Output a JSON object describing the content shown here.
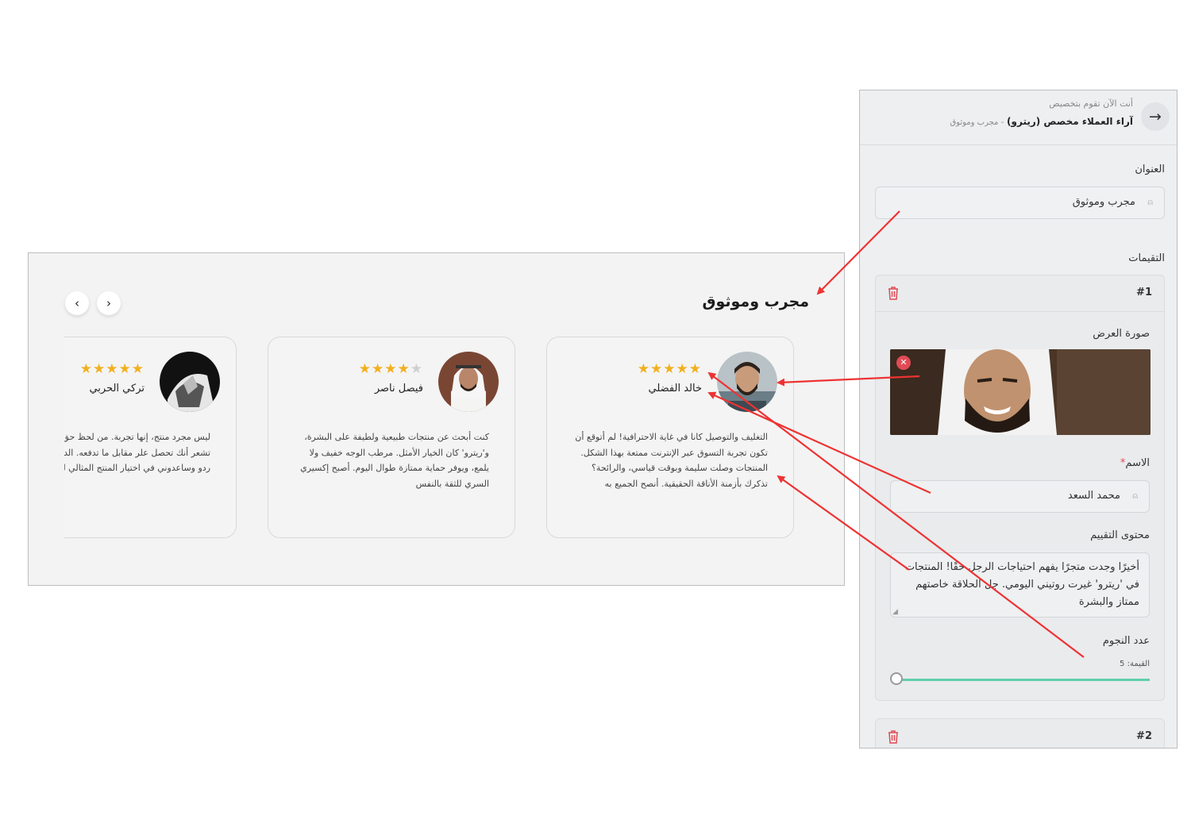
{
  "preview": {
    "section_title": "مجرب وموثوق",
    "prev_label": "‹",
    "next_label": "›",
    "cards": [
      {
        "name": "خالد الفضلي",
        "rating": 5,
        "stars": "★★★★★",
        "text": "التغليف والتوصيل كانا في غاية الاحترافية! لم أتوقع أن تكون تجربة التسوق عبر الإنترنت ممتعة بهذا الشكل. المنتجات وصلت سليمة وبوقت قياسي، والرائحة؟ تذكرك بأزمنة الأناقة الحقيقية. أنصح الجميع به"
      },
      {
        "name": "فيصل ناصر",
        "rating": 4,
        "stars_on": "★★★★",
        "stars_off": "★",
        "text": "كنت أبحث عن منتجات طبيعية ولطيفة على البشرة، و'ريترو' كان الخيار الأمثل. مرطب الوجه خفيف ولا يلمع، ويوفر حماية ممتازة طوال اليوم. أصبح إكسيري السري للثقة بالنفس"
      },
      {
        "name": "تركي الحربي",
        "rating": 5,
        "stars": "★★★★★",
        "text": "ليس مجرد منتج، إنها تجربة. من لحظ حق الاستخدام، تشعر أنك تحصل علر مقابل ما تدفعه. الدعم الفني كان ردو وساعدوني في اختيار المنتج المثالي لشد"
      }
    ]
  },
  "panel": {
    "subtitle": "أنت الآن تقوم بتخصيص",
    "title": "آراء العملاء مخصص (ريترو)",
    "crumb": "- مجرب وموثوق",
    "back_icon": "arrow-right-icon",
    "title_label": "العنوان",
    "title_value": "مجرب وموثوق",
    "ratings_label": "التقيمات",
    "items": [
      {
        "number": "#1",
        "image_label": "صورة العرض",
        "name_label": "الاسم",
        "required_mark": "*",
        "name_value": "محمد السعد",
        "content_label": "محتوى التقييم",
        "content_value": "أخيرًا وجدت متجرًا يفهم احتياجات الرجل حقًا! المنتجات في 'ريترو' غيرت روتيني اليومي. جل الحلاقة خاصتهم ممتاز والبشرة",
        "stars_label": "عدد النجوم",
        "stars_value_text": "القيمة: 5",
        "stars_value": 5
      },
      {
        "number": "#2"
      }
    ]
  },
  "colors": {
    "star": "#f2b01e",
    "slider": "#5fd0a8",
    "danger": "#e04b55",
    "annotation_arrow": "#ee3333"
  }
}
